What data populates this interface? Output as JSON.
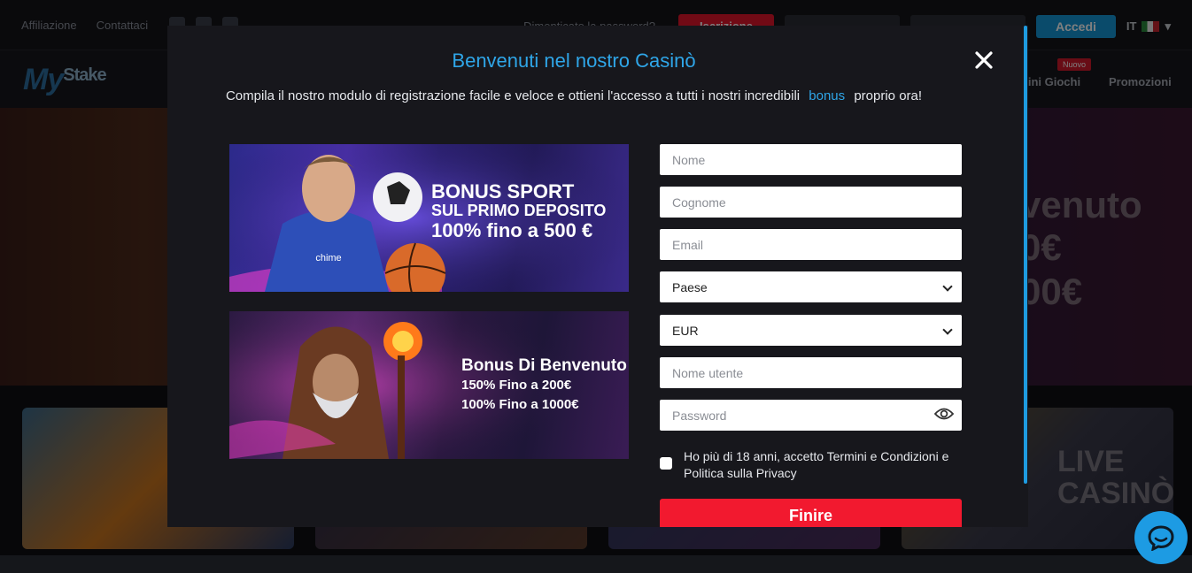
{
  "background": {
    "topbar": {
      "links": [
        "Affiliazione",
        "Contattaci"
      ],
      "forgot_password": "Dimenticato la password?",
      "signup_label": "Iscrizione",
      "login_label": "Accedi",
      "language": "IT"
    },
    "navbar": {
      "logo_my": "My",
      "logo_stake": "Stake",
      "items": [
        "Mini Giochi",
        "Promozioni"
      ],
      "new_badge": "Nuovo"
    },
    "hero": {
      "lines": [
        "venuto",
        "0€",
        "00€"
      ]
    },
    "tiles": {
      "live_line1": "LIVE",
      "live_line2": "CASINÒ"
    }
  },
  "modal": {
    "title": "Benvenuti nel nostro Casinò",
    "subtitle_before": "Compila il nostro modulo di registrazione facile e veloce e ottieni l'accesso a tutti i nostri incredibili",
    "subtitle_link": "bonus",
    "subtitle_after": "proprio ora!",
    "banner_sport": {
      "line1": "BONUS SPORT",
      "line2": "SUL PRIMO DEPOSITO",
      "line3": "100% fino a 500 €"
    },
    "banner_bonus": {
      "line1": "Bonus Di Benvenuto",
      "line2": "150% Fino a 200€",
      "line3": "100% Fino a 1000€"
    },
    "form": {
      "first_name_placeholder": "Nome",
      "last_name_placeholder": "Cognome",
      "email_placeholder": "Email",
      "country_selected": "Paese",
      "currency_selected": "EUR",
      "username_placeholder": "Nome utente",
      "password_placeholder": "Password",
      "terms_label": "Ho più di 18 anni, accetto Termini e Condizioni e Politica sulla Privacy",
      "submit_label": "Finire"
    }
  },
  "colors": {
    "accent_blue": "#2fa6e8",
    "submit_red": "#f2192f",
    "modal_bg": "#17171c"
  }
}
